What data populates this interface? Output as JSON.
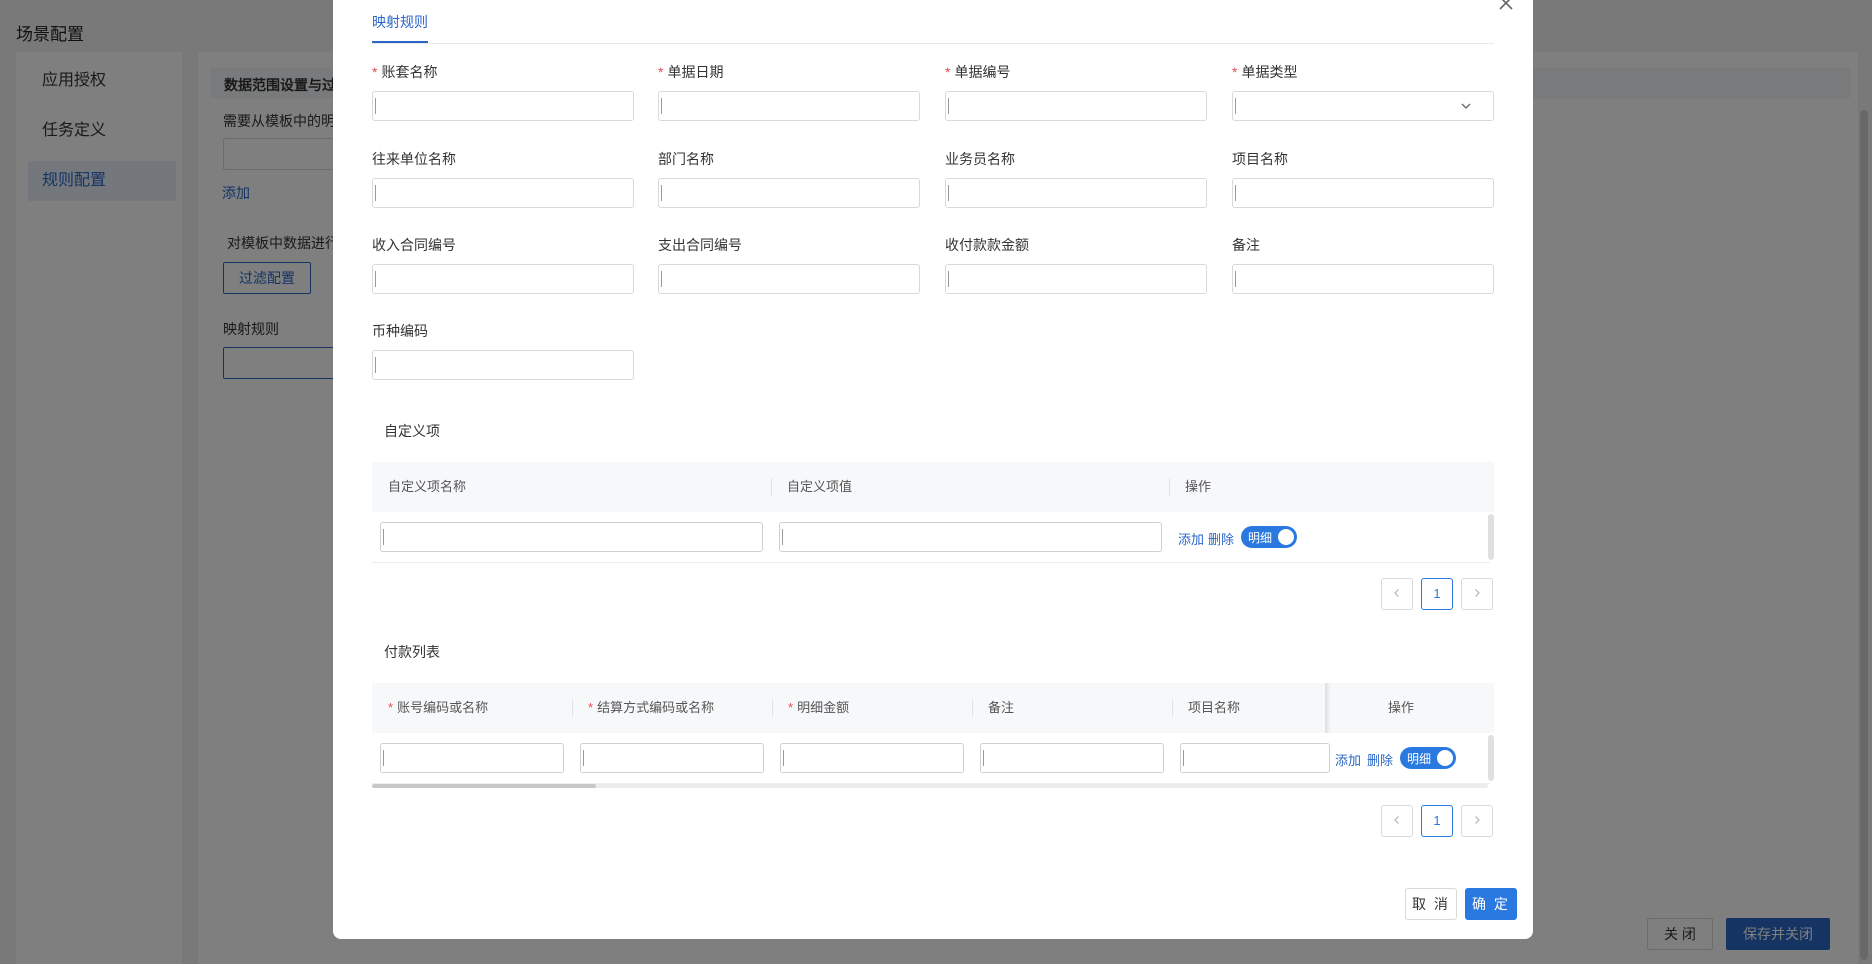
{
  "background": {
    "page_title": "场景配置",
    "nav": [
      {
        "label": "应用授权",
        "active": false
      },
      {
        "label": "任务定义",
        "active": false
      },
      {
        "label": "规则配置",
        "active": true
      }
    ],
    "section_header": "数据范围设置与过",
    "hint_text": "需要从模板中的明",
    "add_link": "添加",
    "filter_hint": "对模板中数据进行",
    "filter_button": "过滤配置",
    "mapping_label": "映射规则",
    "close_button": "关 闭",
    "save_close_button": "保存并关闭"
  },
  "modal": {
    "tab_label": "映射规则",
    "fields": [
      {
        "label": "账套名称",
        "required": true,
        "type": "text",
        "value": ""
      },
      {
        "label": "单据日期",
        "required": true,
        "type": "text",
        "value": ""
      },
      {
        "label": "单据编号",
        "required": true,
        "type": "text",
        "value": ""
      },
      {
        "label": "单据类型",
        "required": true,
        "type": "select",
        "value": ""
      },
      {
        "label": "往来单位名称",
        "required": false,
        "type": "text",
        "value": ""
      },
      {
        "label": "部门名称",
        "required": false,
        "type": "text",
        "value": ""
      },
      {
        "label": "业务员名称",
        "required": false,
        "type": "text",
        "value": ""
      },
      {
        "label": "项目名称",
        "required": false,
        "type": "text",
        "value": ""
      },
      {
        "label": "收入合同编号",
        "required": false,
        "type": "text",
        "value": ""
      },
      {
        "label": "支出合同编号",
        "required": false,
        "type": "text",
        "value": ""
      },
      {
        "label": "收付款款金额",
        "required": false,
        "type": "text",
        "value": ""
      },
      {
        "label": "备注",
        "required": false,
        "type": "text",
        "value": ""
      },
      {
        "label": "币种编码",
        "required": false,
        "type": "text",
        "value": ""
      }
    ],
    "custom_section": {
      "title": "自定义项",
      "columns": [
        "自定义项名称",
        "自定义项值",
        "操作"
      ],
      "row": {
        "name": "",
        "value": "",
        "add": "添加",
        "delete": "删除",
        "toggle_label": "明细",
        "toggle_on": true
      },
      "page": "1"
    },
    "payment_section": {
      "title": "付款列表",
      "columns": [
        {
          "label": "账号编码或名称",
          "required": true
        },
        {
          "label": "结算方式编码或名称",
          "required": true
        },
        {
          "label": "明细金额",
          "required": true
        },
        {
          "label": "备注",
          "required": false
        },
        {
          "label": "项目名称",
          "required": false
        },
        {
          "label": "操作",
          "required": false
        }
      ],
      "row": {
        "add": "添加",
        "delete": "删除",
        "toggle_label": "明细",
        "toggle_on": true
      },
      "page": "1"
    },
    "cancel_button": "取 消",
    "ok_button": "确 定"
  },
  "colors": {
    "accent": "#2a79e0",
    "link": "#2a66c7",
    "required": "#e34d59"
  }
}
